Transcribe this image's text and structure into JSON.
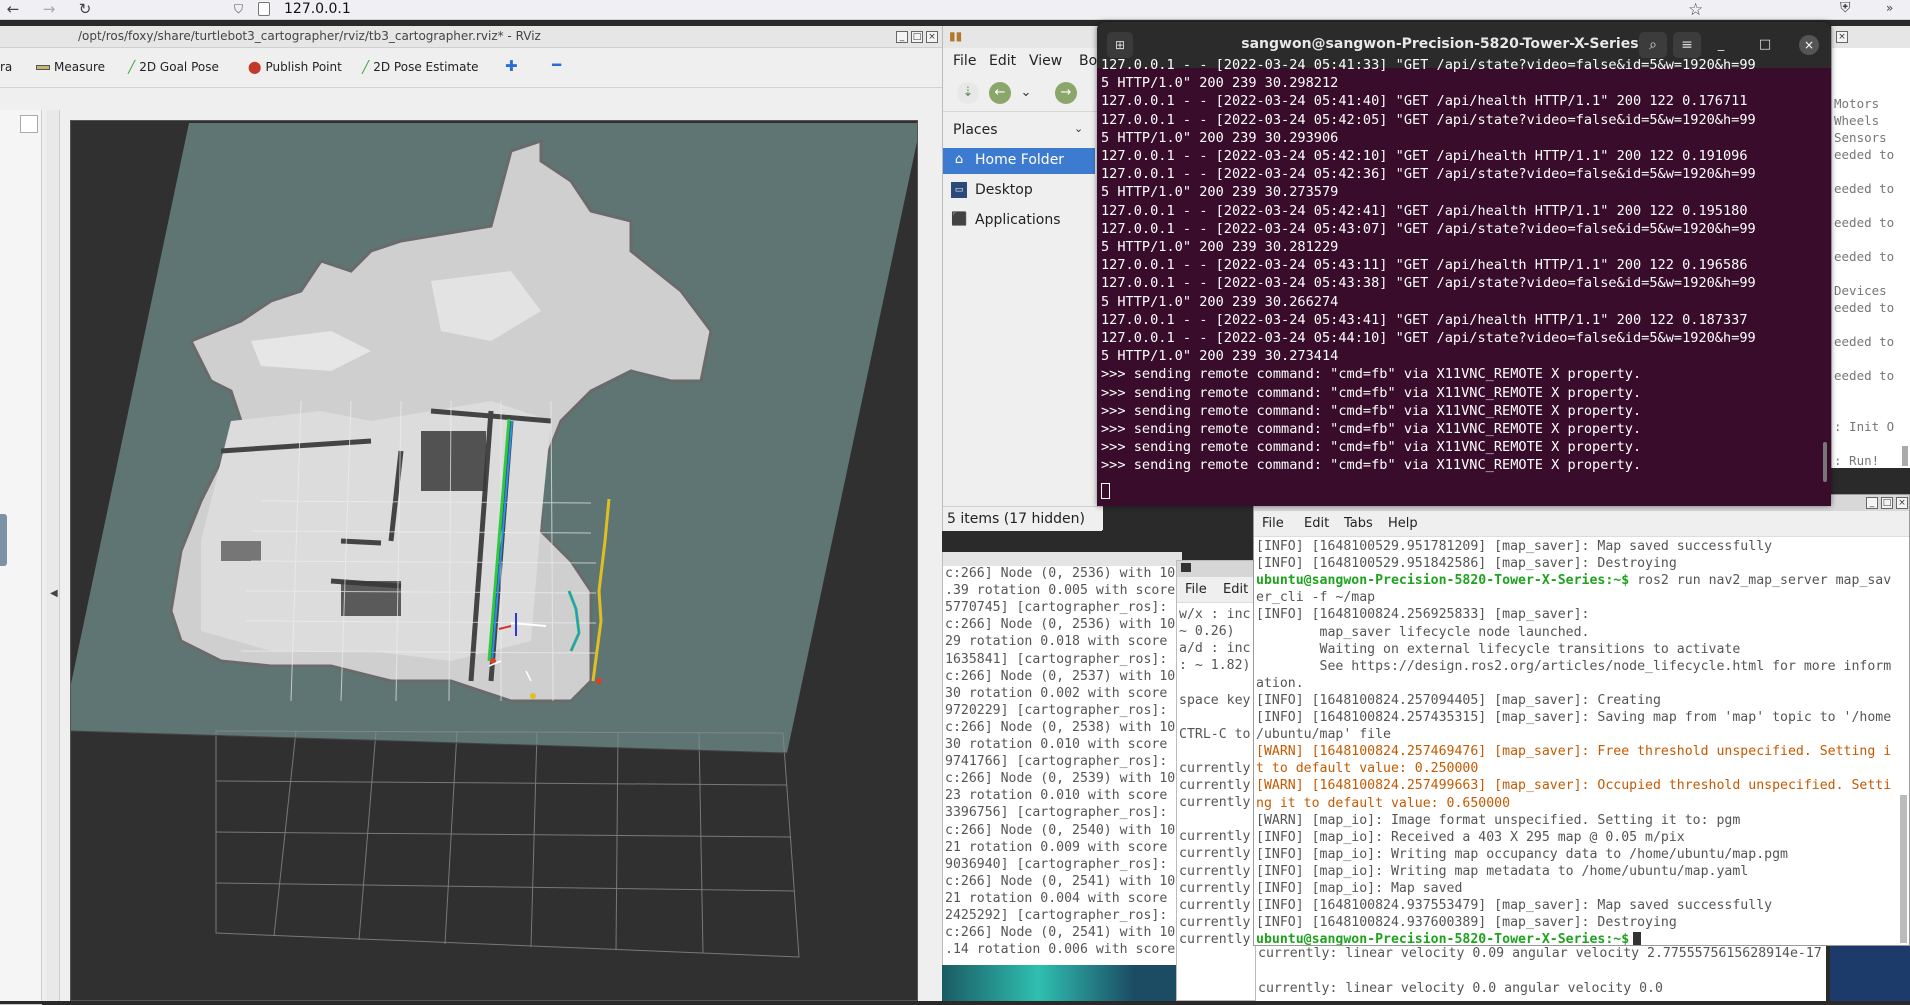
{
  "browser": {
    "url": "127.0.0.1"
  },
  "rviz": {
    "title": "/opt/ros/foxy/share/turtlebot3_cartographer/rviz/tb3_cartographer.rviz* - RViz",
    "toolbar": {
      "camera_label": "ra",
      "measure_label": "Measure",
      "goal_label": "2D Goal Pose",
      "publish_label": "Publish Point",
      "pose_label": "2D Pose Estimate"
    }
  },
  "file_manager": {
    "menu": [
      "File",
      "Edit",
      "View",
      "Bo"
    ],
    "places_label": "Places",
    "items": [
      "Home Folder",
      "Desktop",
      "Applications"
    ],
    "status": "5 items (17 hidden)"
  },
  "dark_terminal": {
    "title": "sangwon@sangwon-Precision-5820-Tower-X-Series: ~",
    "lines": [
      "127.0.0.1 - - [2022-03-24 05:41:33] \"GET /api/state?video=false&id=5&w=1920&h=99",
      "5 HTTP/1.0\" 200 239 30.298212",
      "127.0.0.1 - - [2022-03-24 05:41:40] \"GET /api/health HTTP/1.1\" 200 122 0.176711",
      "127.0.0.1 - - [2022-03-24 05:42:05] \"GET /api/state?video=false&id=5&w=1920&h=99",
      "5 HTTP/1.0\" 200 239 30.293906",
      "127.0.0.1 - - [2022-03-24 05:42:10] \"GET /api/health HTTP/1.1\" 200 122 0.191096",
      "127.0.0.1 - - [2022-03-24 05:42:36] \"GET /api/state?video=false&id=5&w=1920&h=99",
      "5 HTTP/1.0\" 200 239 30.273579",
      "127.0.0.1 - - [2022-03-24 05:42:41] \"GET /api/health HTTP/1.1\" 200 122 0.195180",
      "127.0.0.1 - - [2022-03-24 05:43:07] \"GET /api/state?video=false&id=5&w=1920&h=99",
      "5 HTTP/1.0\" 200 239 30.281229",
      "127.0.0.1 - - [2022-03-24 05:43:11] \"GET /api/health HTTP/1.1\" 200 122 0.196586",
      "127.0.0.1 - - [2022-03-24 05:43:38] \"GET /api/state?video=false&id=5&w=1920&h=99",
      "5 HTTP/1.0\" 200 239 30.266274",
      "127.0.0.1 - - [2022-03-24 05:43:41] \"GET /api/health HTTP/1.1\" 200 122 0.187337",
      "127.0.0.1 - - [2022-03-24 05:44:10] \"GET /api/state?video=false&id=5&w=1920&h=99",
      "5 HTTP/1.0\" 200 239 30.273414",
      ">>> sending remote command: \"cmd=fb\" via X11VNC_REMOTE X property.",
      ">>> sending remote command: \"cmd=fb\" via X11VNC_REMOTE X property.",
      ">>> sending remote command: \"cmd=fb\" via X11VNC_REMOTE X property.",
      ">>> sending remote command: \"cmd=fb\" via X11VNC_REMOTE X property.",
      ">>> sending remote command: \"cmd=fb\" via X11VNC_REMOTE X property.",
      ">>> sending remote command: \"cmd=fb\" via X11VNC_REMOTE X property."
    ]
  },
  "carto_log": {
    "lines": [
      "c:266] Node (0, 2536) with 100 poi",
      ".39 rotation 0.005 with score",
      "5770745] [cartographer_ros]:",
      "c:266] Node (0, 2536) with 10",
      "29 rotation 0.018 with score",
      "1635841] [cartographer_ros]:",
      "c:266] Node (0, 2537) with 10",
      "30 rotation 0.002 with score",
      "9720229] [cartographer_ros]:",
      "c:266] Node (0, 2538) with 10",
      "30 rotation 0.010 with score",
      "9741766] [cartographer_ros]:",
      "c:266] Node (0, 2539) with 10",
      "23 rotation 0.010 with score",
      "3396756] [cartographer_ros]:",
      "c:266] Node (0, 2540) with 10",
      "21 rotation 0.009 with score",
      "9036940] [cartographer_ros]:",
      "c:266] Node (0, 2541) with 10",
      "21 rotation 0.004 with score",
      "2425292] [cartographer_ros]:",
      "c:266] Node (0, 2541) with 10",
      ".14 rotation 0.006 with score"
    ]
  },
  "teleop": {
    "menu": [
      "File",
      "Edit"
    ],
    "lines": [
      "w/x : inc",
      " ~ 0.26)",
      "a/d : inc",
      ": ~ 1.82)",
      "",
      "space key",
      "",
      "CTRL-C to",
      "",
      "currently",
      "currently",
      "currently",
      "",
      "currently",
      "currently",
      "currently",
      "currently",
      "currently",
      "currently",
      "currently"
    ],
    "bottom_lines": [
      "currently:      linear velocity 0.09     angular velocity 2.7755575615628914e-17",
      "",
      "currently:      linear velocity 0.0      angular velocity 0.0"
    ]
  },
  "far_right": {
    "lines": [
      "Motors",
      "Wheels",
      "Sensors",
      "eeded to",
      "",
      "eeded to",
      "",
      "eeded to",
      "",
      "eeded to",
      "",
      "Devices",
      "eeded to",
      "",
      "eeded to",
      "",
      "eeded to",
      "",
      "",
      ": Init O",
      "",
      ": Run!"
    ]
  },
  "map_terminal": {
    "menu": [
      "File",
      "Edit",
      "Tabs",
      "Help"
    ],
    "lines": [
      {
        "t": "[INFO] [1648100529.951781209] [map_saver]: Map saved successfully",
        "c": "info"
      },
      {
        "t": "[INFO] [1648100529.951842586] [map_saver]: Destroying",
        "c": "info"
      },
      {
        "t": "ubuntu@sangwon-Precision-5820-Tower-X-Series:~$",
        "c": "prompt",
        "rest": " ros2 run nav2_map_server map_sav"
      },
      {
        "t": "er_cli -f ~/map",
        "c": "info"
      },
      {
        "t": "[INFO] [1648100824.256925833] [map_saver]:",
        "c": "info"
      },
      {
        "t": "        map_saver lifecycle node launched.",
        "c": "info"
      },
      {
        "t": "        Waiting on external lifecycle transitions to activate",
        "c": "info"
      },
      {
        "t": "        See https://design.ros2.org/articles/node_lifecycle.html for more inform",
        "c": "info"
      },
      {
        "t": "ation.",
        "c": "info"
      },
      {
        "t": "[INFO] [1648100824.257094405] [map_saver]: Creating",
        "c": "info"
      },
      {
        "t": "[INFO] [1648100824.257435315] [map_saver]: Saving map from 'map' topic to '/home",
        "c": "info"
      },
      {
        "t": "/ubuntu/map' file",
        "c": "info"
      },
      {
        "t": "[WARN] [1648100824.257469476] [map_saver]: Free threshold unspecified. Setting i",
        "c": "warn"
      },
      {
        "t": "t to default value: 0.250000",
        "c": "warn"
      },
      {
        "t": "[WARN] [1648100824.257499663] [map_saver]: Occupied threshold unspecified. Setti",
        "c": "warn"
      },
      {
        "t": "ng it to default value: 0.650000",
        "c": "warn"
      },
      {
        "t": "[WARN] [map_io]: Image format unspecified. Setting it to: pgm",
        "c": "info"
      },
      {
        "t": "[INFO] [map_io]: Received a 403 X 295 map @ 0.05 m/pix",
        "c": "info"
      },
      {
        "t": "[INFO] [map_io]: Writing map occupancy data to /home/ubuntu/map.pgm",
        "c": "info"
      },
      {
        "t": "[INFO] [map_io]: Writing map metadata to /home/ubuntu/map.yaml",
        "c": "info"
      },
      {
        "t": "[INFO] [map_io]: Map saved",
        "c": "info"
      },
      {
        "t": "[INFO] [1648100824.937553479] [map_saver]: Map saved successfully",
        "c": "info"
      },
      {
        "t": "[INFO] [1648100824.937600389] [map_saver]: Destroying",
        "c": "info"
      },
      {
        "t": "ubuntu@sangwon-Precision-5820-Tower-X-Series:~$",
        "c": "prompt",
        "rest": ""
      }
    ]
  },
  "colors": {
    "terminal_bg": "#380c2a",
    "selection": "#3d7bd0",
    "prompt_green": "#1fa31f",
    "warn_orange": "#c55a00",
    "map_plane": "#5f7574"
  }
}
